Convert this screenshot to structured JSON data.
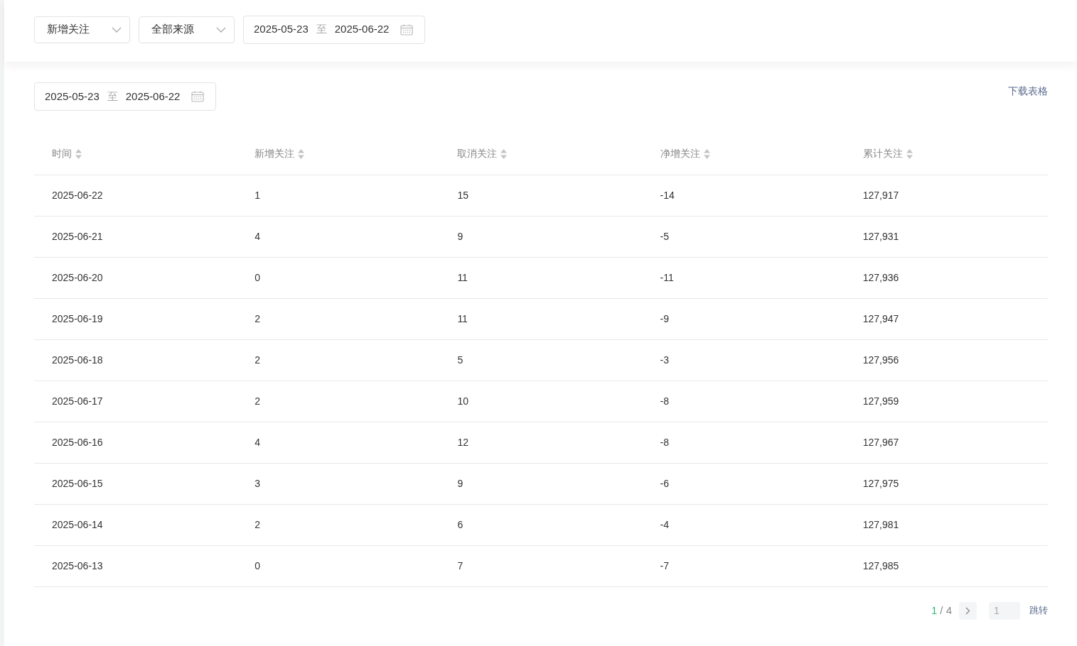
{
  "filters": {
    "metric_select": "新增关注",
    "source_select": "全部来源",
    "date_range": {
      "start": "2025-05-23",
      "separator": "至",
      "end": "2025-06-22"
    }
  },
  "table_tools": {
    "date_range": {
      "start": "2025-05-23",
      "separator": "至",
      "end": "2025-06-22"
    },
    "download_link": "下载表格"
  },
  "table": {
    "columns": [
      "时间",
      "新增关注",
      "取消关注",
      "净增关注",
      "累计关注"
    ],
    "rows": [
      [
        "2025-06-22",
        "1",
        "15",
        "-14",
        "127,917"
      ],
      [
        "2025-06-21",
        "4",
        "9",
        "-5",
        "127,931"
      ],
      [
        "2025-06-20",
        "0",
        "11",
        "-11",
        "127,936"
      ],
      [
        "2025-06-19",
        "2",
        "11",
        "-9",
        "127,947"
      ],
      [
        "2025-06-18",
        "2",
        "5",
        "-3",
        "127,956"
      ],
      [
        "2025-06-17",
        "2",
        "10",
        "-8",
        "127,959"
      ],
      [
        "2025-06-16",
        "4",
        "12",
        "-8",
        "127,967"
      ],
      [
        "2025-06-15",
        "3",
        "9",
        "-6",
        "127,975"
      ],
      [
        "2025-06-14",
        "2",
        "6",
        "-4",
        "127,981"
      ],
      [
        "2025-06-13",
        "0",
        "7",
        "-7",
        "127,985"
      ]
    ]
  },
  "pagination": {
    "current": "1",
    "total": "/ 4",
    "page_input": "1",
    "jump_button": "跳转"
  }
}
